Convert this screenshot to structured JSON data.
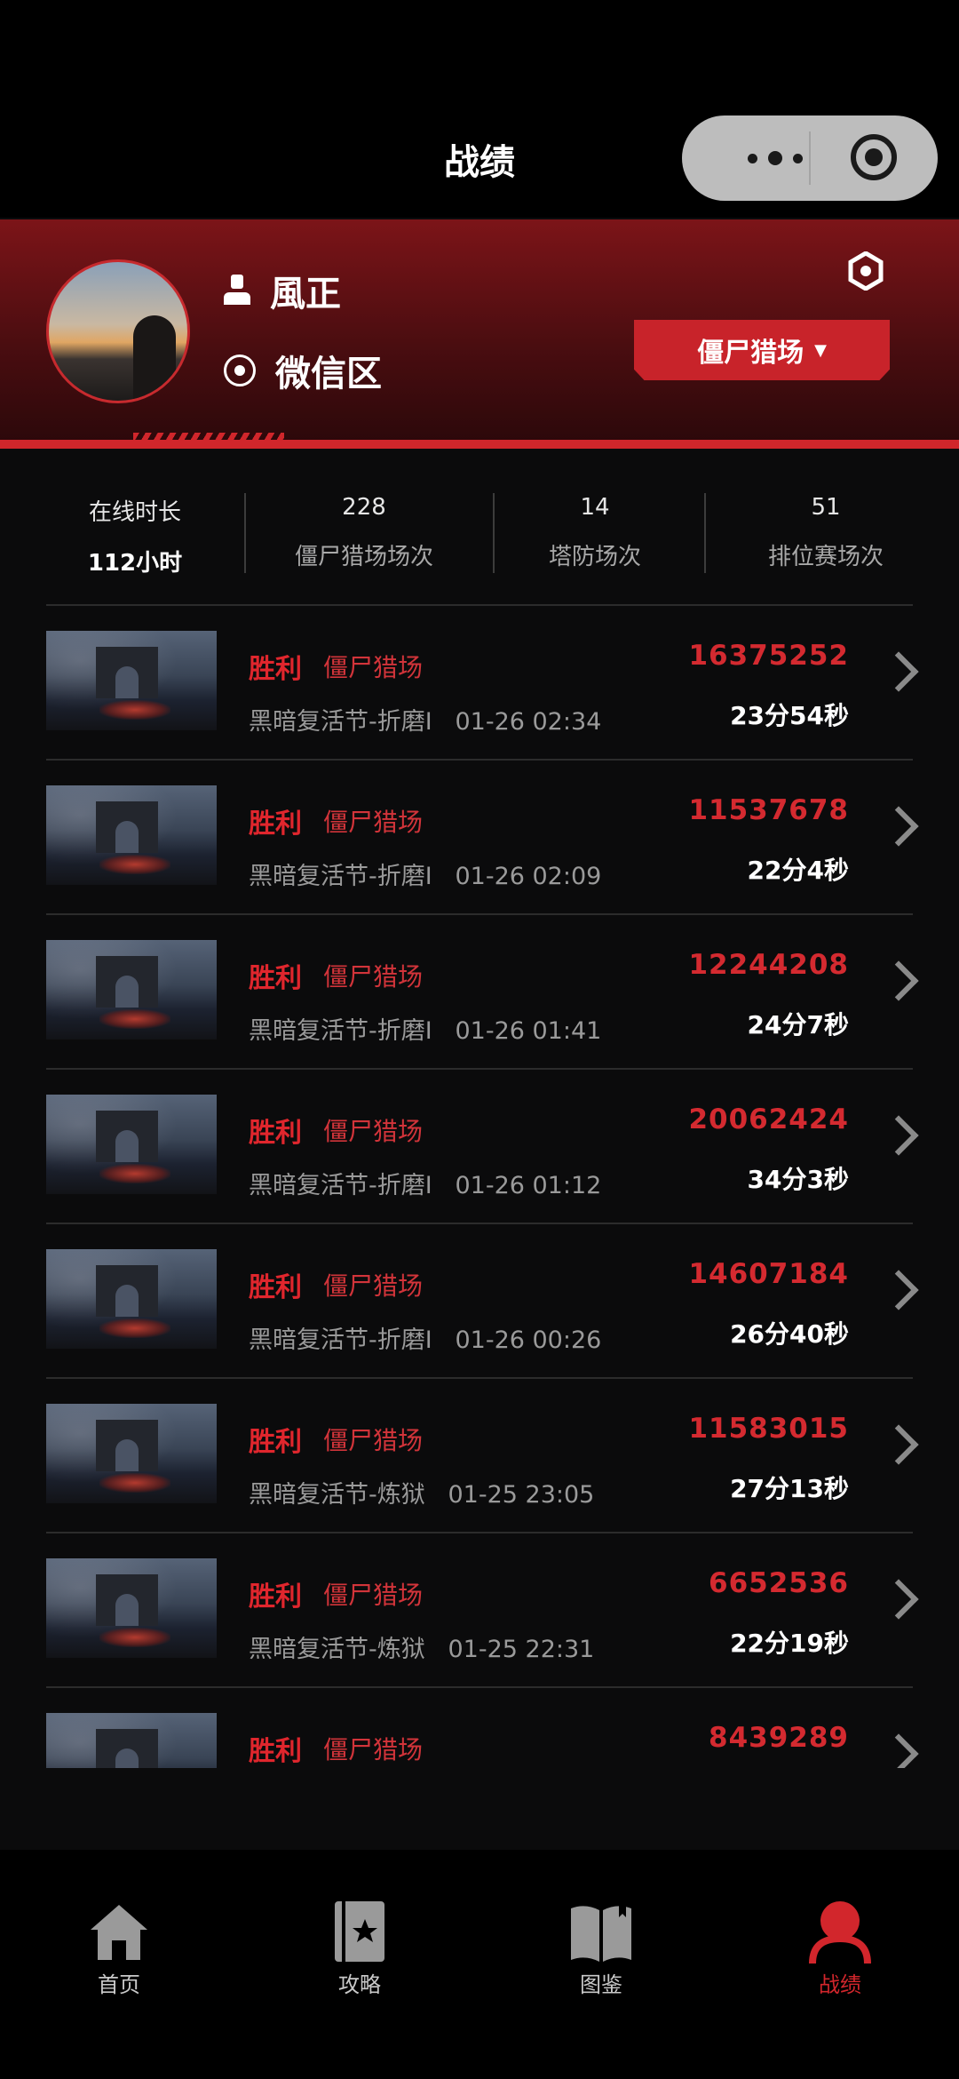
{
  "header": {
    "title": "战绩"
  },
  "profile": {
    "name": "風正",
    "region": "微信区",
    "mode_selector": "僵尸猎场",
    "mode_caret": "▼"
  },
  "stats": [
    {
      "top": "在线时长",
      "bottom": "112小时"
    },
    {
      "top": "228",
      "bottom": "僵尸猎场场次"
    },
    {
      "top": "14",
      "bottom": "塔防场次"
    },
    {
      "top": "51",
      "bottom": "排位赛场次"
    }
  ],
  "matches": [
    {
      "result": "胜利",
      "mode": "僵尸猎场",
      "map": "黑暗复活节-折磨I",
      "time": "01-26 02:34",
      "score": "16375252",
      "duration": "23分54秒"
    },
    {
      "result": "胜利",
      "mode": "僵尸猎场",
      "map": "黑暗复活节-折磨I",
      "time": "01-26 02:09",
      "score": "11537678",
      "duration": "22分4秒"
    },
    {
      "result": "胜利",
      "mode": "僵尸猎场",
      "map": "黑暗复活节-折磨I",
      "time": "01-26 01:41",
      "score": "12244208",
      "duration": "24分7秒"
    },
    {
      "result": "胜利",
      "mode": "僵尸猎场",
      "map": "黑暗复活节-折磨I",
      "time": "01-26 01:12",
      "score": "20062424",
      "duration": "34分3秒"
    },
    {
      "result": "胜利",
      "mode": "僵尸猎场",
      "map": "黑暗复活节-折磨I",
      "time": "01-26 00:26",
      "score": "14607184",
      "duration": "26分40秒"
    },
    {
      "result": "胜利",
      "mode": "僵尸猎场",
      "map": "黑暗复活节-炼狱",
      "time": "01-25 23:05",
      "score": "11583015",
      "duration": "27分13秒"
    },
    {
      "result": "胜利",
      "mode": "僵尸猎场",
      "map": "黑暗复活节-炼狱",
      "time": "01-25 22:31",
      "score": "6652536",
      "duration": "22分19秒"
    },
    {
      "result": "胜利",
      "mode": "僵尸猎场",
      "map": "",
      "time": "",
      "score": "8439289",
      "duration": ""
    }
  ],
  "tabs": [
    {
      "label": "首页",
      "icon": "home-icon"
    },
    {
      "label": "攻略",
      "icon": "guide-book-icon"
    },
    {
      "label": "图鉴",
      "icon": "codex-book-icon"
    },
    {
      "label": "战绩",
      "icon": "profile-icon",
      "active": true
    }
  ],
  "colors": {
    "accent": "#d2262c",
    "background": "#0b0b0c",
    "banner": "#6e1216"
  }
}
